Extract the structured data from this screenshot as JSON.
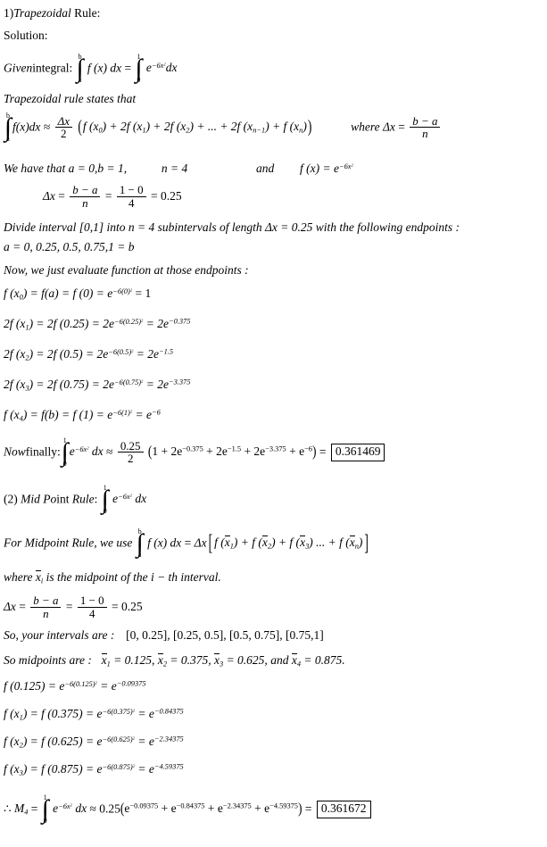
{
  "document": {
    "title_line": "1)Trapezoidal Rule:",
    "title_number": "1)",
    "title_term": "Trapezoidal",
    "title_rest": " Rule:",
    "solution_label": "Solution:"
  },
  "trapezoid": {
    "given_label": "Given",
    "given_rest": "integral:",
    "integrand": "e",
    "exponent": "−6x",
    "exponent_sq": "2",
    "dx": "dx",
    "fx_dx": "f (x) dx",
    "limit_lower_ab": "a",
    "limit_upper_ab": "b",
    "limit_lower_01": "0",
    "limit_upper_01": "1",
    "states_that": "Trapezoidal rule states that",
    "rule_lhs": "f(x)dx",
    "approx": "≈",
    "frac_num": "Δx",
    "frac_den": "2",
    "rule_terms": "(f (x0) + 2f (x1) + 2f (x2) + ... + 2f (xn−1) + f (xn))",
    "where_label": "where",
    "delta_x": "Δx",
    "equals": "=",
    "ba_num": "b − a",
    "ba_den": "n",
    "we_have_that": "We have that",
    "a_val": "a = 0,",
    "b_val": "b = 1,",
    "n_val": "n = 4",
    "and_label": "and",
    "fx_label": "f (x) =",
    "dx_calc_num2": "1 − 0",
    "dx_calc_den2": "4",
    "dx_result": "= 0.25",
    "divide_interval": "Divide interval [0,1] into n = 4 subintervals of length Δx = 0.25 with the following endpoints :",
    "endpoints": "a = 0, 0.25, 0.5, 0.75,1 = b",
    "now_evaluate": "Now, we just evaluate function at those endpoints :",
    "evaluations": [
      {
        "lhs": "f (x0) = f(a) = f (0) = e",
        "exp_inner": "−6(0)",
        "result": "= 1",
        "sub": "0",
        "label": "f-x0"
      },
      {
        "lhs": "2f (x1) = 2f (0.25) = 2e",
        "exp_inner": "−6(0.25)",
        "result": "= 2e",
        "result_exp": "−0.375",
        "sub": "1",
        "label": "f-x1"
      },
      {
        "lhs": "2f (x2) = 2f (0.5) = 2e",
        "exp_inner": "−6(0.5)",
        "result": "= 2e",
        "result_exp": "−1.5",
        "sub": "2",
        "label": "f-x2"
      },
      {
        "lhs": "2f (x3) = 2f (0.75) = 2e",
        "exp_inner": "−6(0.75)",
        "result": "= 2e",
        "result_exp": "−3.375",
        "sub": "3",
        "label": "f-x3"
      },
      {
        "lhs": "f (x4) = f(b) = f (1) = e",
        "exp_inner": "−6(1)",
        "result": "= e",
        "result_exp": "−6",
        "sub": "4",
        "label": "f-x4"
      }
    ],
    "now_finally_label": "Now",
    "now_finally_rest": "finally:",
    "final_coef_num": "0.25",
    "final_coef_den": "2",
    "final_terms_1": "1 + 2e",
    "final_exp_1": "−0.375",
    "final_terms_2": " + 2e",
    "final_exp_2": "−1.5",
    "final_terms_3": " + 2e",
    "final_exp_3": "−3.375",
    "final_terms_4": " + e",
    "final_exp_4": "−6",
    "final_equals": "=",
    "answer": "0.361469"
  },
  "midpoint": {
    "heading_num": "(2)",
    "heading_term": "Mid Po",
    "heading_term2": "int Rule",
    "heading_colon": ":",
    "for_midpoint": "For Midpoint Rule, we use",
    "fx_dx": "f (x) dx",
    "equals": "=",
    "delta_x": "Δx",
    "bracket_terms": "[f (x̅1) + f (x̅2) + f (x̅3) ... + f (x̅n)]",
    "bar_subs": [
      "1",
      "2",
      "3",
      "n"
    ],
    "where_xi_1": "where",
    "where_xi_2": "is the midpoint of the i − th interval.",
    "xi_sub": "i",
    "dx_line_num": "b − a",
    "dx_line_den": "n",
    "dx_line_num2": "1 − 0",
    "dx_line_den2": "4",
    "dx_line_result": "= 0.25",
    "intervals_label": "So, your intervals are :",
    "intervals": [
      "[0, 0.25],",
      "[0.25, 0.5],",
      "[0.5, 0.75],",
      "[0.75,1]"
    ],
    "midpoints_label": "So midpoints are :",
    "midpoints": [
      {
        "sub": "1",
        "value": "= 0.125,"
      },
      {
        "sub": "2",
        "value": "= 0.375,"
      },
      {
        "sub": "3",
        "value": "= 0.625,"
      },
      {
        "sub": "4",
        "value": "= 0.875."
      }
    ],
    "midpoints_and": "and",
    "evaluations": [
      {
        "lhs": "f (0.125) = e",
        "exp_inner": "−6(0.125)",
        "result": "= e",
        "result_exp": "−0.09375",
        "label": "f-mid-0125"
      },
      {
        "lhs": "f (x1) = f (0.375) = e",
        "exp_inner": "−6(0.375)",
        "result": "= e",
        "result_exp": "−0.84375",
        "sub": "1",
        "label": "f-mid-0375"
      },
      {
        "lhs": "f (x2) = f (0.625) = e",
        "exp_inner": "−6(0.625)",
        "result": "= e",
        "result_exp": "−2.34375",
        "sub": "2",
        "label": "f-mid-0625"
      },
      {
        "lhs": "f (x3) = f (0.875) = e",
        "exp_inner": "−6(0.875)",
        "result": "= e",
        "result_exp": "−4.59375",
        "sub": "3",
        "label": "f-mid-0875"
      }
    ],
    "therefore": "∴",
    "M_label": "M",
    "M_sub": "4",
    "M_equals": "=",
    "M_coef": "0.25",
    "M_terms_1": "e",
    "M_exp_1": "−0.09375",
    "M_terms_2": " + e",
    "M_exp_2": "−0.84375",
    "M_terms_3": " + e",
    "M_exp_3": "−2.34375",
    "M_terms_4": " + e",
    "M_exp_4": "−4.59375",
    "answer": "0.361672"
  },
  "symbols": {
    "integral": "∫",
    "approx": "≈",
    "delta": "Δ",
    "minus": "−"
  },
  "colors": {
    "text": "#000000",
    "background": "#ffffff",
    "box_border": "#000000"
  }
}
